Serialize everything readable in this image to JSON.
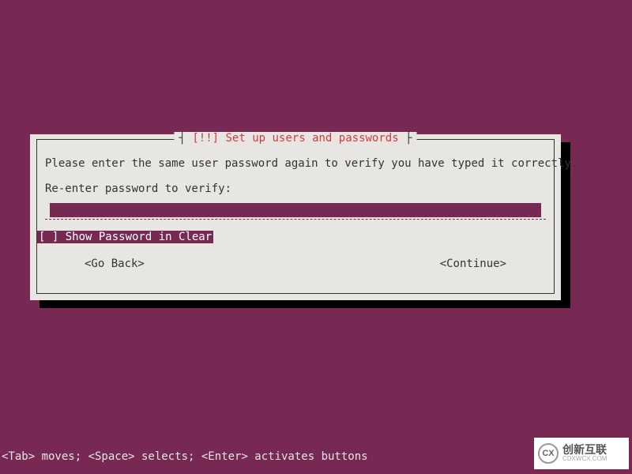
{
  "dialog": {
    "title_prefix": "┤ ",
    "title_alert": "[!!] ",
    "title_text": "Set up users and passwords",
    "title_suffix": " ├",
    "instruction": "Please enter the same user password again to verify you have typed it correctly.",
    "label": "Re-enter password to verify:",
    "password_value": "",
    "checkbox": {
      "state_unchecked": "[ ] ",
      "label": "Show Password in Clear"
    },
    "go_back": "<Go Back>",
    "continue": "<Continue>"
  },
  "help_line": "<Tab> moves; <Space> selects; <Enter> activates buttons",
  "watermark": {
    "logo": "CX",
    "name": "创新互联",
    "url": "CDXWCX.COM"
  }
}
